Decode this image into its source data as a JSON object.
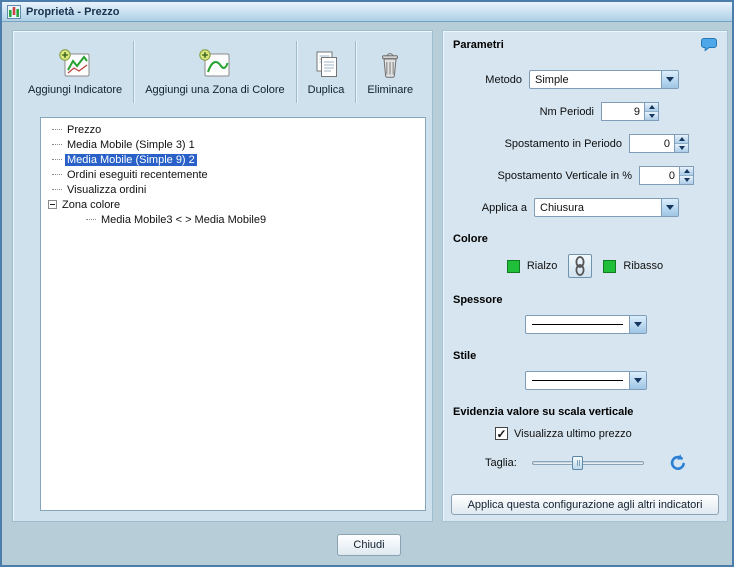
{
  "window": {
    "title": "Proprietà - Prezzo"
  },
  "toolbar": {
    "add_indicator_label": "Aggiungi Indicatore",
    "add_color_zone_label": "Aggiungi una Zona di Colore",
    "duplicate_label": "Duplica",
    "delete_label": "Eliminare"
  },
  "tree": {
    "items": [
      {
        "label": "Prezzo",
        "selected": false
      },
      {
        "label": "Media Mobile (Simple 3) 1",
        "selected": false
      },
      {
        "label": "Media Mobile (Simple 9) 2",
        "selected": true
      },
      {
        "label": "Ordini eseguiti recentemente",
        "selected": false
      },
      {
        "label": "Visualizza ordini",
        "selected": false
      },
      {
        "label": "Zona colore",
        "selected": false,
        "expanded": true
      },
      {
        "label": "Media Mobile3 < > Media Mobile9",
        "selected": false,
        "child": true
      }
    ]
  },
  "parameters": {
    "title": "Parametri",
    "method_label": "Metodo",
    "method_value": "Simple",
    "periods_label": "Nm Periodi",
    "periods_value": "9",
    "shift_period_label": "Spostamento in Periodo",
    "shift_period_value": "0",
    "shift_vertical_label": "Spostamento Verticale in %",
    "shift_vertical_value": "0",
    "apply_to_label": "Applica a",
    "apply_to_value": "Chiusura"
  },
  "color": {
    "title": "Colore",
    "up_label": "Rialzo",
    "down_label": "Ribasso",
    "up_color": "#1fbf3a",
    "down_color": "#1fbf3a",
    "linked": true
  },
  "thickness": {
    "title": "Spessore"
  },
  "line_style": {
    "title": "Stile"
  },
  "highlight": {
    "title": "Evidenzia valore su scala verticale",
    "checkbox_label": "Visualizza ultimo prezzo",
    "checkbox_checked": true,
    "size_label": "Taglia:"
  },
  "actions": {
    "apply_all_label": "Applica questa configurazione agli altri indicatori",
    "close_label": "Chiudi"
  },
  "icons": {
    "help": "speech-bubble",
    "link": "chain-link",
    "reset": "undo-circular-arrow",
    "selection_color": "#2a61c8"
  }
}
